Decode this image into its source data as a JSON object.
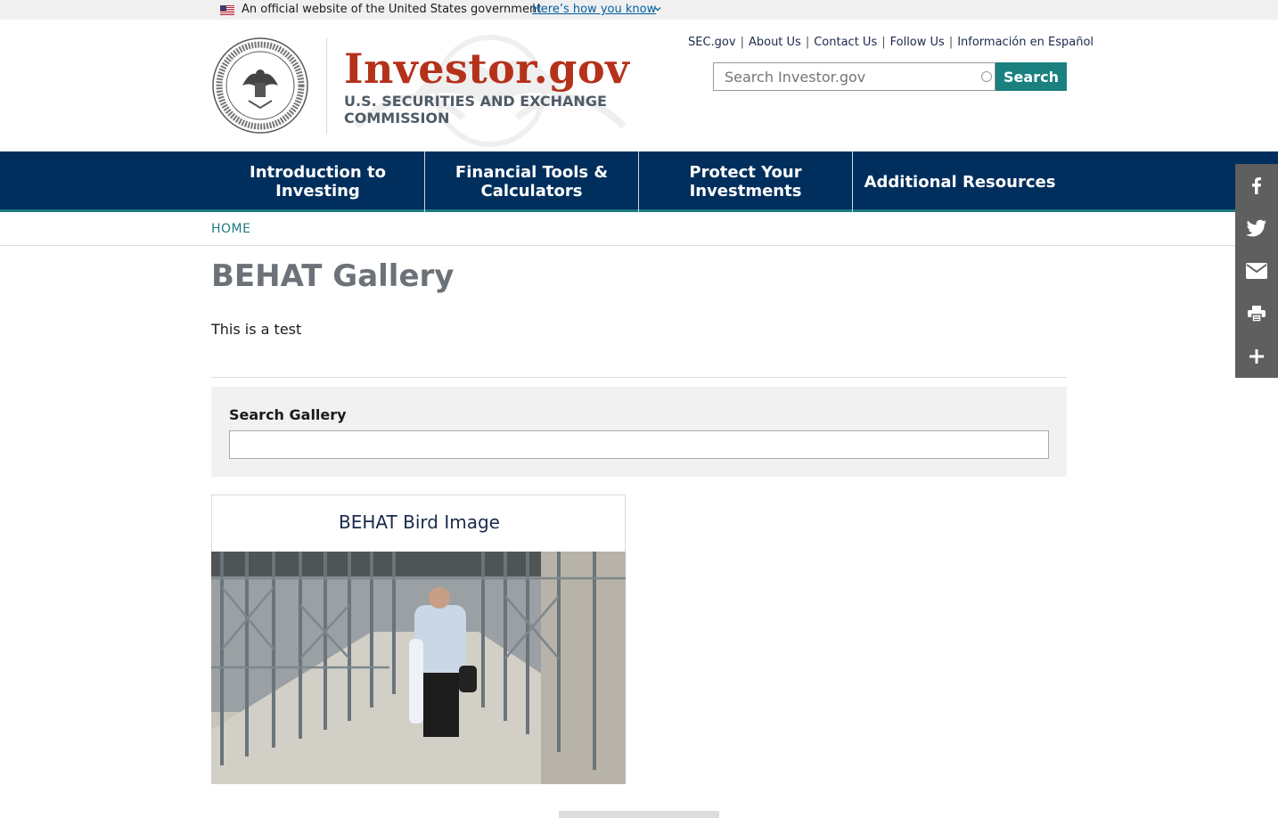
{
  "gov_banner": {
    "text": "An official website of the United States government",
    "link": "Here’s how you know"
  },
  "logo": {
    "title": "Investor.gov",
    "subtitle": "U.S. Securities and Exchange Commission"
  },
  "util_nav": [
    "SEC.gov",
    "About Us",
    "Contact Us",
    "Follow Us",
    "Información en Español"
  ],
  "search": {
    "placeholder": "Search Investor.gov",
    "button": "Search"
  },
  "main_nav": [
    "Introduction to Investing",
    "Financial Tools & Calculators",
    "Protect Your Investments",
    "Additional Resources"
  ],
  "breadcrumb": "HOME",
  "page": {
    "title": "BEHAT Gallery",
    "intro": "This is a test"
  },
  "filter": {
    "label": "Search Gallery",
    "value": ""
  },
  "gallery": [
    {
      "title": "BEHAT Bird Image"
    }
  ],
  "social_icons": [
    "facebook-icon",
    "twitter-icon",
    "email-icon",
    "print-icon",
    "plus-icon"
  ],
  "colors": {
    "nav_bg": "#002f5d",
    "brand_red": "#b5321a",
    "teal": "#1a8080",
    "social_bg": "#5f5f5f"
  }
}
